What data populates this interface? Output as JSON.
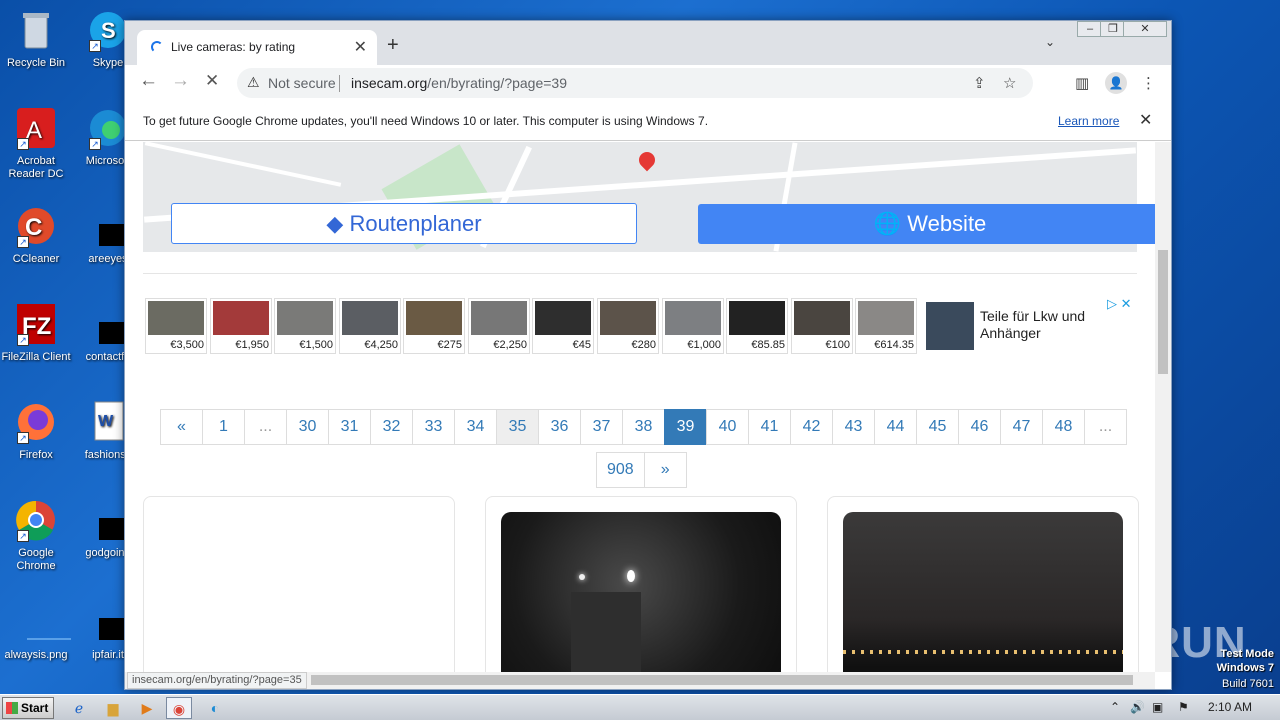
{
  "desktop": {
    "icons": [
      {
        "label": "Recycle Bin",
        "icon": "recycle-bin-icon"
      },
      {
        "label": "Skype",
        "icon": "skype-icon"
      },
      {
        "label": "Acrobat Reader DC",
        "icon": "acrobat-icon"
      },
      {
        "label": "Microsoft",
        "icon": "edge-icon"
      },
      {
        "label": "CCleaner",
        "icon": "ccleaner-icon"
      },
      {
        "label": "areeyes",
        "icon": "file-icon"
      },
      {
        "label": "FileZilla Client",
        "icon": "filezilla-icon"
      },
      {
        "label": "contactfri",
        "icon": "file-icon"
      },
      {
        "label": "Firefox",
        "icon": "firefox-icon"
      },
      {
        "label": "fashionsy",
        "icon": "word-icon"
      },
      {
        "label": "Google Chrome",
        "icon": "chrome-icon"
      },
      {
        "label": "godgoing",
        "icon": "file-icon"
      },
      {
        "label": "alwaysis.png",
        "icon": "image-icon"
      },
      {
        "label": "ipfair.it",
        "icon": "file-icon"
      }
    ]
  },
  "browser": {
    "tab_title": "Live cameras: by rating",
    "url_host": "insecam.org",
    "url_path": "/en/byrating/?page=39",
    "not_secure": "Not secure",
    "infobar_message": "To get future Google Chrome updates, you'll need Windows 10 or later. This computer is using Windows 7.",
    "infobar_link": "Learn more",
    "status_url": "insecam.org/en/byrating/?page=35"
  },
  "page": {
    "route_button": "Routenplaner",
    "website_button": "Website",
    "ad": {
      "prices": [
        "€3,500",
        "€1,950",
        "€1,500",
        "€4,250",
        "€275",
        "€2,250",
        "€45",
        "€280",
        "€1,000",
        "€85.85",
        "€100",
        "€614.35"
      ],
      "text": "Teile für Lkw und Anhänger"
    },
    "pagination": {
      "row1": [
        "«",
        "1",
        "...",
        "30",
        "31",
        "32",
        "33",
        "34",
        "35",
        "36",
        "37",
        "38",
        "39",
        "40",
        "41",
        "42",
        "43",
        "44",
        "45",
        "46",
        "47",
        "48",
        "..."
      ],
      "row2": [
        "908",
        "»"
      ],
      "current": "39",
      "hovered": "35"
    }
  },
  "taskbar": {
    "start_label": "Start",
    "time": "2:10 AM"
  },
  "watermark": {
    "line1": "Test Mode",
    "line2": "Windows 7",
    "line3": "Build 7601",
    "brand": "ANY RUN"
  }
}
